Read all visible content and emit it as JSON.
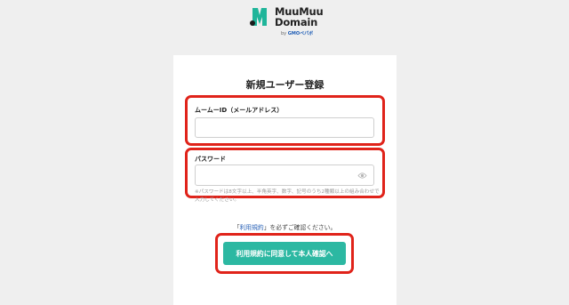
{
  "logo": {
    "brand_line1": "MuuMuu",
    "brand_line2": "Domain",
    "by_prefix": "by",
    "by_company": "GMOペパボ"
  },
  "form": {
    "title": "新規ユーザー登録",
    "email": {
      "label": "ムームーID（メールアドレス）",
      "value": "",
      "placeholder": ""
    },
    "password": {
      "label": "パスワード",
      "value": "",
      "placeholder": "",
      "toggle_icon": "eye-icon",
      "hint": "※パスワードは8文字以上、半角英字、数字、記号のうち2種類以上の組み合わせで入力してください。"
    },
    "terms": {
      "prefix": "「",
      "link": "利用規約",
      "suffix": "」を必ずご確認ください。"
    },
    "submit_label": "利用規約に同意して本人確認へ"
  },
  "colors": {
    "accent": "#2cb8a2",
    "highlight": "#e0231a",
    "link": "#2a62b7",
    "background": "#efefef"
  }
}
